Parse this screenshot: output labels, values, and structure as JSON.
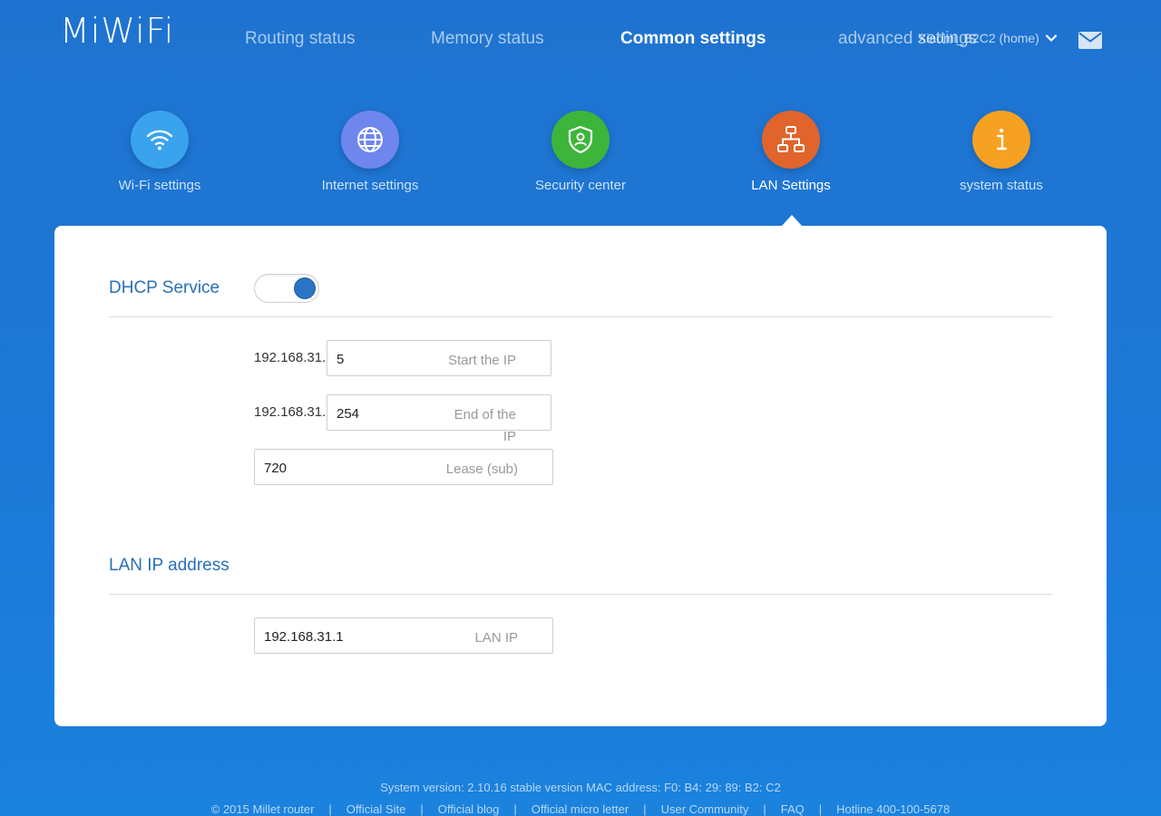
{
  "brand": {
    "logo": "MiWiFi"
  },
  "nav": [
    {
      "label": "Routing status",
      "active": false
    },
    {
      "label": "Memory status",
      "active": false
    },
    {
      "label": "Common settings",
      "active": true
    },
    {
      "label": "advanced settings",
      "active": false
    }
  ],
  "account": {
    "label": "Xiaomi_B2C2 (home)"
  },
  "tiles": [
    {
      "label": "Wi-Fi settings",
      "icon": "wifi-icon",
      "color": "#3aa3ee"
    },
    {
      "label": "Internet settings",
      "icon": "globe-icon",
      "color": "#6f86ee"
    },
    {
      "label": "Security center",
      "icon": "shield-icon",
      "color": "#3db53b"
    },
    {
      "label": "LAN Settings",
      "icon": "network-icon",
      "color": "#e0642c",
      "active": true
    },
    {
      "label": "system status",
      "icon": "info-icon",
      "color": "#f6a121"
    }
  ],
  "dhcp": {
    "title": "DHCP Service",
    "enabled": true,
    "start": {
      "prefix": "192.168.31.",
      "value": "5",
      "hint": "Start the IP"
    },
    "end": {
      "prefix": "192.168.31.",
      "value": "254",
      "hint": "End of the IP"
    },
    "lease": {
      "value": "720",
      "hint": "Lease (sub)"
    }
  },
  "lan": {
    "title": "LAN IP address",
    "ip": {
      "value": "192.168.31.1",
      "hint": "LAN IP"
    }
  },
  "footer": {
    "version_line": "System version: 2.10.16 stable version MAC address: F0: B4: 29: 89: B2: C2",
    "links": [
      "© 2015 Millet router",
      "Official Site",
      "Official blog",
      "Official micro letter",
      "User Community",
      "FAQ",
      "Hotline 400-100-5678"
    ]
  }
}
